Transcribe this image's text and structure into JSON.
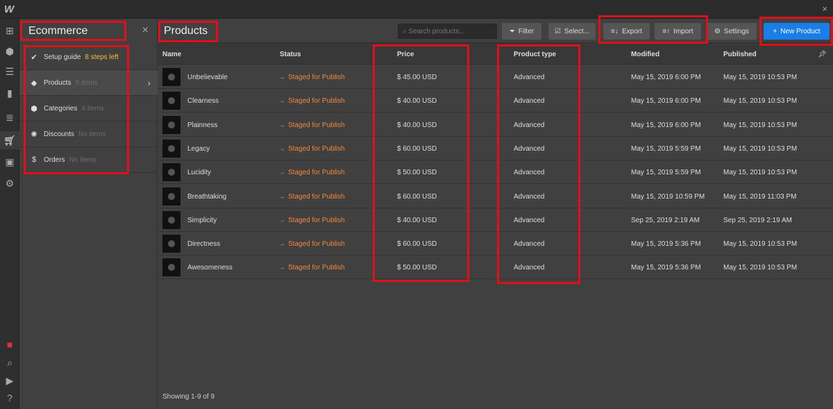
{
  "app": {
    "logo": "W",
    "close": "×"
  },
  "rail": {
    "icons": [
      "add-panel-icon",
      "cube-icon",
      "navigator-icon",
      "pages-icon",
      "cms-icon",
      "ecommerce-icon",
      "assets-icon",
      "settings-icon",
      "record-icon",
      "search-icon",
      "video-icon",
      "help-icon"
    ]
  },
  "sidebar": {
    "title": "Ecommerce",
    "close": "×",
    "setup": {
      "label": "Setup guide",
      "badge": "8 steps left"
    },
    "items": [
      {
        "label": "Products",
        "sub": "9 items",
        "icon": "tag-icon",
        "glyph": "◆"
      },
      {
        "label": "Categories",
        "sub": "4 items",
        "icon": "box-icon",
        "glyph": "⬢"
      },
      {
        "label": "Discounts",
        "sub": "No items",
        "icon": "discount-icon",
        "glyph": "✺"
      },
      {
        "label": "Orders",
        "sub": "No items",
        "icon": "receipt-icon",
        "glyph": "$"
      }
    ]
  },
  "main": {
    "title": "Products",
    "search_placeholder": "Search products...",
    "buttons": {
      "filter": "Filter",
      "select": "Select...",
      "export": "Export",
      "import": "Import",
      "settings": "Settings",
      "new": "New Product"
    },
    "columns": [
      "Name",
      "Status",
      "Price",
      "Product type",
      "Modified",
      "Published"
    ],
    "rows": [
      {
        "name": "Unbelievable",
        "status": "Staged for Publish",
        "price": "$ 45.00 USD",
        "type": "Advanced",
        "modified": "May 15, 2019 6:00 PM",
        "published": "May 15, 2019 10:53 PM"
      },
      {
        "name": "Clearness",
        "status": "Staged for Publish",
        "price": "$ 40.00 USD",
        "type": "Advanced",
        "modified": "May 15, 2019 6:00 PM",
        "published": "May 15, 2019 10:53 PM"
      },
      {
        "name": "Plainness",
        "status": "Staged for Publish",
        "price": "$ 40.00 USD",
        "type": "Advanced",
        "modified": "May 15, 2019 6:00 PM",
        "published": "May 15, 2019 10:53 PM"
      },
      {
        "name": "Legacy",
        "status": "Staged for Publish",
        "price": "$ 60.00 USD",
        "type": "Advanced",
        "modified": "May 15, 2019 5:59 PM",
        "published": "May 15, 2019 10:53 PM"
      },
      {
        "name": "Lucidity",
        "status": "Staged for Publish",
        "price": "$ 50.00 USD",
        "type": "Advanced",
        "modified": "May 15, 2019 5:59 PM",
        "published": "May 15, 2019 10:53 PM"
      },
      {
        "name": "Breathtaking",
        "status": "Staged for Publish",
        "price": "$ 60.00 USD",
        "type": "Advanced",
        "modified": "May 15, 2019 10:59 PM",
        "published": "May 15, 2019 11:03 PM"
      },
      {
        "name": "Simplicity",
        "status": "Staged for Publish",
        "price": "$ 40.00 USD",
        "type": "Advanced",
        "modified": "Sep 25, 2019 2:19 AM",
        "published": "Sep 25, 2019 2:19 AM"
      },
      {
        "name": "Directness",
        "status": "Staged for Publish",
        "price": "$ 60.00 USD",
        "type": "Advanced",
        "modified": "May 15, 2019 5:36 PM",
        "published": "May 15, 2019 10:53 PM"
      },
      {
        "name": "Awesomeness",
        "status": "Staged for Publish",
        "price": "$ 50.00 USD",
        "type": "Advanced",
        "modified": "May 15, 2019 5:36 PM",
        "published": "May 15, 2019 10:53 PM"
      }
    ],
    "footer": "Showing 1-9 of 9"
  },
  "colors": {
    "accent": "#1a7ee8",
    "status": "#f08a3c",
    "warning": "#f0c239",
    "annotation": "#e0101a"
  }
}
